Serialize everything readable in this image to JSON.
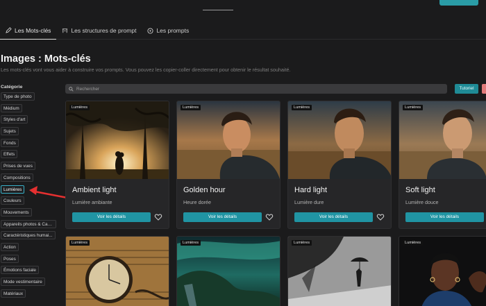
{
  "nav": {
    "tabs": [
      {
        "label": "Les Mots-clés",
        "icon": "pen-icon",
        "active": true
      },
      {
        "label": "Les structures de prompt",
        "icon": "structure-icon",
        "active": false
      },
      {
        "label": "Les prompts",
        "icon": "compass-icon",
        "active": false
      }
    ]
  },
  "page": {
    "title": "Images : Mots-clés",
    "subtitle": "Les mots-clés vont vous aider à construire vos prompts. Vous pouvez les copier-coller directement pour obtenir le résultat souhaité."
  },
  "sidebar": {
    "label": "Catégorie",
    "items": [
      {
        "label": "Type de photo"
      },
      {
        "label": "Médium"
      },
      {
        "label": "Styles d'art"
      },
      {
        "label": "Sujets"
      },
      {
        "label": "Fonds"
      },
      {
        "label": "Effets"
      },
      {
        "label": "Prises de vues"
      },
      {
        "label": "Compositions"
      },
      {
        "label": "Lumières",
        "active": true
      },
      {
        "label": "Couleurs"
      },
      {
        "label": "Mouvements"
      },
      {
        "label": "Appareils photos & Cam..."
      },
      {
        "label": "Caractéristiques humai..."
      },
      {
        "label": "Action"
      },
      {
        "label": "Poses"
      },
      {
        "label": "Émotions faciale"
      },
      {
        "label": "Mode vestimentaire"
      },
      {
        "label": "Matériaux"
      }
    ]
  },
  "search": {
    "placeholder": "Rechercher"
  },
  "toolbar": {
    "tutorial_label": "Tutoriel"
  },
  "cards": [
    {
      "badge": "Lumières",
      "title": "Ambient light",
      "subtitle": "Lumière ambiante",
      "button": "Voir les détails"
    },
    {
      "badge": "Lumières",
      "title": "Golden hour",
      "subtitle": "Heure dorée",
      "button": "Voir les détails"
    },
    {
      "badge": "Lumières",
      "title": "Hard light",
      "subtitle": "Lumière dure",
      "button": "Voir les détails"
    },
    {
      "badge": "Lumières",
      "title": "Soft light",
      "subtitle": "Lumière douce",
      "button": "Voir les détails"
    }
  ],
  "cards_row2": [
    {
      "badge": "Lumières"
    },
    {
      "badge": "Lumières"
    },
    {
      "badge": "Lumières"
    },
    {
      "badge": "Lumières"
    }
  ],
  "colors": {
    "accent": "#2094a3",
    "background": "#1b1b1c",
    "active_border": "#38b0c8",
    "annotation_arrow": "#e53030"
  }
}
